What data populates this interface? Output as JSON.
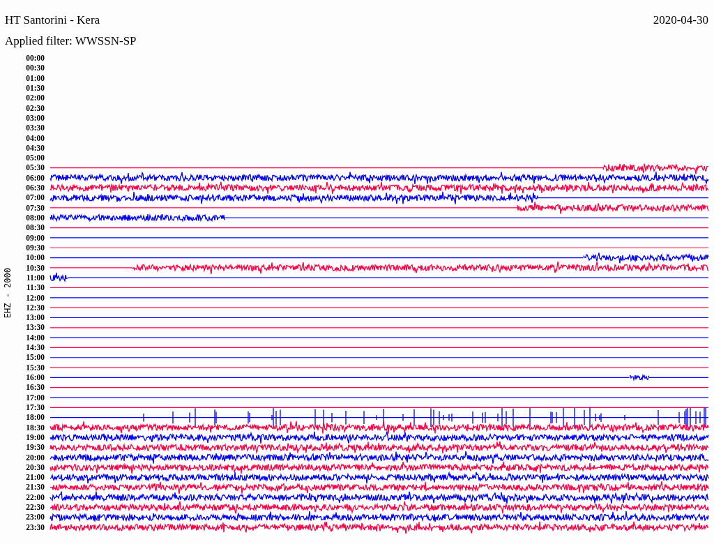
{
  "header": {
    "title": "HT Santorini - Kera",
    "date": "2020-04-30",
    "filter": "Applied filter: WWSSN-SP"
  },
  "axis_label": "EHZ - 2000",
  "rows": [
    {
      "time": "00:00",
      "kind": "none"
    },
    {
      "time": "00:30",
      "kind": "none"
    },
    {
      "time": "01:00",
      "kind": "none"
    },
    {
      "time": "01:30",
      "kind": "none"
    },
    {
      "time": "02:00",
      "kind": "none"
    },
    {
      "time": "02:30",
      "kind": "none"
    },
    {
      "time": "03:00",
      "kind": "none"
    },
    {
      "time": "03:30",
      "kind": "none"
    },
    {
      "time": "04:00",
      "kind": "none"
    },
    {
      "time": "04:30",
      "kind": "none"
    },
    {
      "time": "05:00",
      "kind": "none"
    },
    {
      "time": "05:30",
      "kind": "tail"
    },
    {
      "time": "06:00",
      "kind": "noise"
    },
    {
      "time": "06:30",
      "kind": "noise"
    },
    {
      "time": "07:00",
      "kind": "head"
    },
    {
      "time": "07:30",
      "kind": "tail"
    },
    {
      "time": "08:00",
      "kind": "head"
    },
    {
      "time": "08:30",
      "kind": "line"
    },
    {
      "time": "09:00",
      "kind": "line"
    },
    {
      "time": "09:30",
      "kind": "line"
    },
    {
      "time": "10:00",
      "kind": "tail"
    },
    {
      "time": "10:30",
      "kind": "tail"
    },
    {
      "time": "11:00",
      "kind": "head"
    },
    {
      "time": "11:30",
      "kind": "line"
    },
    {
      "time": "12:00",
      "kind": "line"
    },
    {
      "time": "12:30",
      "kind": "line"
    },
    {
      "time": "13:00",
      "kind": "line"
    },
    {
      "time": "13:30",
      "kind": "line"
    },
    {
      "time": "14:00",
      "kind": "line"
    },
    {
      "time": "14:30",
      "kind": "line"
    },
    {
      "time": "15:00",
      "kind": "line"
    },
    {
      "time": "15:30",
      "kind": "line"
    },
    {
      "time": "16:00",
      "kind": "burst"
    },
    {
      "time": "16:30",
      "kind": "line"
    },
    {
      "time": "17:00",
      "kind": "line"
    },
    {
      "time": "17:30",
      "kind": "line"
    },
    {
      "time": "18:00",
      "kind": "spikes"
    },
    {
      "time": "18:30",
      "kind": "noise"
    },
    {
      "time": "19:00",
      "kind": "noise"
    },
    {
      "time": "19:30",
      "kind": "noise"
    },
    {
      "time": "20:00",
      "kind": "noise"
    },
    {
      "time": "20:30",
      "kind": "noise"
    },
    {
      "time": "21:00",
      "kind": "noise"
    },
    {
      "time": "21:30",
      "kind": "noise"
    },
    {
      "time": "22:00",
      "kind": "noise"
    },
    {
      "time": "22:30",
      "kind": "noise"
    },
    {
      "time": "23:00",
      "kind": "noise"
    },
    {
      "time": "23:30",
      "kind": "noise"
    }
  ]
}
